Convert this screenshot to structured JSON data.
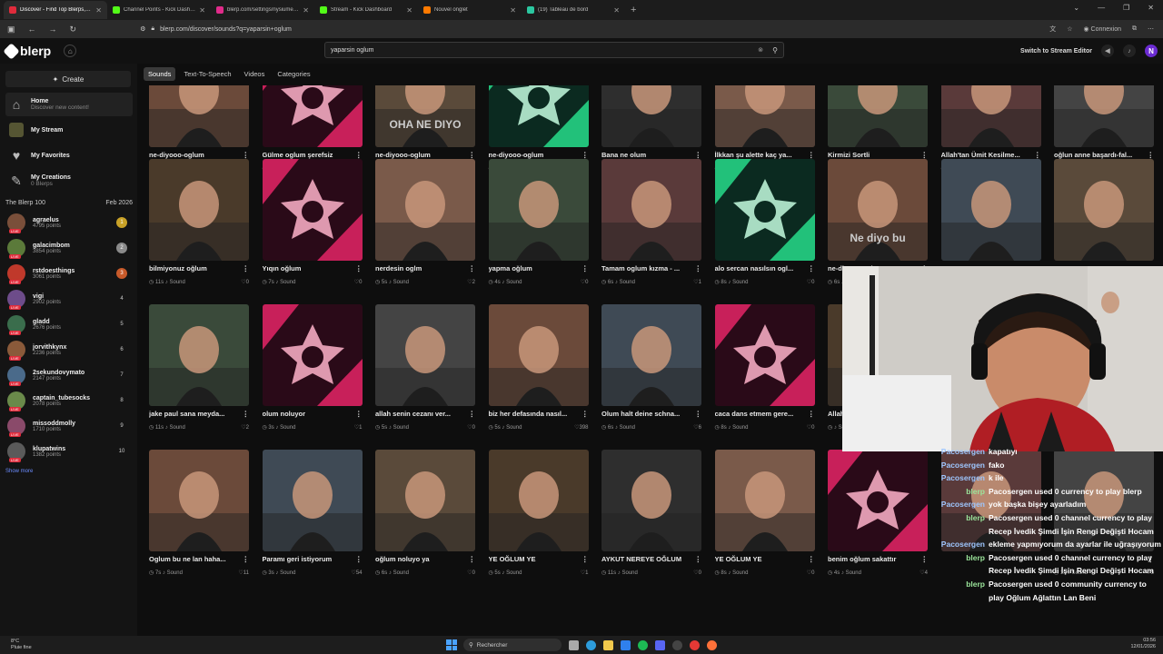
{
  "browser": {
    "tabs": [
      {
        "title": "Discover - Find Top Blerps, Sto",
        "color": "#e02b3b",
        "active": true
      },
      {
        "title": "Channel Points - Kick Dashboar",
        "color": "#53fc18",
        "active": false
      },
      {
        "title": "blerp.com/settings/nysiumerTs",
        "color": "#e02b8a",
        "active": false
      },
      {
        "title": "Stream - Kick Dashboard",
        "color": "#53fc18",
        "active": false
      },
      {
        "title": "Nouvel onglet",
        "color": "#ff7a00",
        "active": false
      },
      {
        "title": "(19) Tableau de bord",
        "color": "#2bc7a0",
        "active": false
      }
    ],
    "url": "blerp.com/discover/sounds?q=yaparsin+oglum",
    "profile_label": "Connexion"
  },
  "site": {
    "logo": "blerp",
    "search_value": "yaparsin oglum",
    "switch_label": "Switch to Stream Editor",
    "avatar_letter": "N"
  },
  "sidebar": {
    "create": "Create",
    "nav": [
      {
        "title": "Home",
        "sub": "Discover new content!"
      },
      {
        "title": "My Stream",
        "sub": ""
      },
      {
        "title": "My Favorites",
        "sub": ""
      },
      {
        "title": "My Creations",
        "sub": "0 Blerps"
      }
    ],
    "board_title": "The Blerp 100",
    "board_date": "Feb 2026",
    "ranks": [
      {
        "name": "agraelus",
        "points": "4795 points",
        "n": "1",
        "color": "#c9a227"
      },
      {
        "name": "galacimbom",
        "points": "3854 points",
        "n": "2",
        "color": "#8a8a8a"
      },
      {
        "name": "rstdoesthings",
        "points": "3061 points",
        "n": "3",
        "color": "#c85a2a"
      },
      {
        "name": "vigi",
        "points": "2902 points",
        "n": "4",
        "color": ""
      },
      {
        "name": "gladd",
        "points": "2676 points",
        "n": "5",
        "color": ""
      },
      {
        "name": "jorvithkynx",
        "points": "2236 points",
        "n": "6",
        "color": ""
      },
      {
        "name": "2sekundovymato",
        "points": "2147 points",
        "n": "7",
        "color": ""
      },
      {
        "name": "captain_tubesocks",
        "points": "2078 points",
        "n": "8",
        "color": ""
      },
      {
        "name": "missoddmolly",
        "points": "1710 points",
        "n": "9",
        "color": ""
      },
      {
        "name": "klupatwins",
        "points": "1382 points",
        "n": "10",
        "color": ""
      }
    ],
    "show_more": "Show more"
  },
  "filters": [
    "Sounds",
    "Text-To-Speech",
    "Videos",
    "Categories"
  ],
  "rows": [
    [
      {
        "title": "ne-diyooo-oglum",
        "dur": "6s",
        "likes": "0",
        "thumb": "photo"
      },
      {
        "title": "Gülme oglum şerefsiz",
        "dur": "3s",
        "likes": "0",
        "thumb": "pink"
      },
      {
        "title": "ne-diyooo-oglum",
        "dur": "6s",
        "likes": "0",
        "thumb": "text",
        "text": "OHA NE DIYO"
      },
      {
        "title": "ne-diyooo-oglum",
        "dur": "6s",
        "likes": "0",
        "thumb": "green"
      },
      {
        "title": "Bana ne olum",
        "dur": "1s",
        "likes": "1",
        "thumb": "photo"
      },
      {
        "title": "İlkkan şu alette kaç ya...",
        "dur": "9s",
        "likes": "5",
        "thumb": "photo"
      },
      {
        "title": "Kirmizi Sortli",
        "dur": "3s",
        "likes": "9",
        "thumb": "photo"
      },
      {
        "title": "Allah'tan Ümit Kesilme...",
        "dur": "5s",
        "likes": "0",
        "thumb": "photo"
      },
      {
        "title": "oğlun anne başardı-fal...",
        "dur": "3s",
        "likes": "0",
        "thumb": "photo"
      }
    ],
    [
      {
        "title": "bilmiyonuz oğlum",
        "dur": "11s",
        "likes": "0",
        "thumb": "photo"
      },
      {
        "title": "Yıqın oğlum",
        "dur": "7s",
        "likes": "0",
        "thumb": "pink"
      },
      {
        "title": "nerdesin oglm",
        "dur": "5s",
        "likes": "2",
        "thumb": "photo"
      },
      {
        "title": "yapma oğlum",
        "dur": "4s",
        "likes": "0",
        "thumb": "photo"
      },
      {
        "title": "Tamam oglum kızma - ...",
        "dur": "6s",
        "likes": "1",
        "thumb": "photo"
      },
      {
        "title": "alo sercan nasılsın ogl...",
        "dur": "8s",
        "likes": "0",
        "thumb": "green"
      },
      {
        "title": "ne-diyooo-oglum",
        "dur": "6s",
        "likes": "0",
        "thumb": "text",
        "text": "Ne diyo bu"
      },
      {
        "title": "",
        "dur": "",
        "likes": "",
        "thumb": "photo"
      },
      {
        "title": "",
        "dur": "",
        "likes": "",
        "thumb": "photo"
      }
    ],
    [
      {
        "title": "jake paul sana meyda...",
        "dur": "11s",
        "likes": "2",
        "thumb": "photo"
      },
      {
        "title": "olum noluyor",
        "dur": "3s",
        "likes": "1",
        "thumb": "pink"
      },
      {
        "title": "allah senin cezanı ver...",
        "dur": "5s",
        "likes": "0",
        "thumb": "photo"
      },
      {
        "title": "biz her defasında nasıl...",
        "dur": "5s",
        "likes": "398",
        "thumb": "photo"
      },
      {
        "title": "Olum halt deine schna...",
        "dur": "6s",
        "likes": "6",
        "thumb": "photo"
      },
      {
        "title": "caca dans etmem gere...",
        "dur": "8s",
        "likes": "0",
        "thumb": "pink"
      },
      {
        "title": "Allah...",
        "dur": "",
        "likes": "",
        "thumb": "photo"
      }
    ],
    [
      {
        "title": "Oglum bu ne lan haha...",
        "dur": "7s",
        "likes": "11",
        "thumb": "photo"
      },
      {
        "title": "Paramı geri istiyorum",
        "dur": "3s",
        "likes": "54",
        "thumb": "photo"
      },
      {
        "title": "oğlum noluyo ya",
        "dur": "6s",
        "likes": "0",
        "thumb": "photo"
      },
      {
        "title": "YE OĞLUM YE",
        "dur": "5s",
        "likes": "1",
        "thumb": "photo"
      },
      {
        "title": "AYKUT NEREYE OĞLUM",
        "dur": "11s",
        "likes": "0",
        "thumb": "photo"
      },
      {
        "title": "YE OĞLUM YE",
        "dur": "8s",
        "likes": "0",
        "thumb": "photo"
      },
      {
        "title": "benim oğlum sakattır",
        "dur": "4s",
        "likes": "4",
        "thumb": "pink"
      },
      {
        "title": "",
        "dur": "",
        "likes": "",
        "thumb": "photo"
      },
      {
        "title": "",
        "dur": "1s",
        "likes": "5",
        "thumb": "photo"
      }
    ]
  ],
  "sound_label": "Sound",
  "chat": [
    {
      "who": "Pacosergen",
      "msg": "kapatıyı",
      "bot": false
    },
    {
      "who": "Pacosergen",
      "msg": "fako",
      "bot": false
    },
    {
      "who": "Pacosergen",
      "msg": "k ile",
      "bot": false
    },
    {
      "who": "blerp",
      "msg": "Pacosergen used 0 currency to play blerp",
      "bot": true
    },
    {
      "who": "Pacosergen",
      "msg": "yok başka bişey ayarladım",
      "bot": false
    },
    {
      "who": "blerp",
      "msg": "Pacosergen used 0 channel currency to play Recep İvedik Şimdi İşin Rengi Değişti Hocam",
      "bot": true
    },
    {
      "who": "Pacosergen",
      "msg": "ekleme yapmıyorum da ayarlar ile uğraşıyorum",
      "bot": false
    },
    {
      "who": "blerp",
      "msg": "Pacosergen used 0 channel currency to play Recep İvedik Şimdi İşin Rengi Değişti Hocam",
      "bot": true
    },
    {
      "who": "blerp",
      "msg": "Pacosergen used 0 community currency to play Oğlum Ağlattın Lan Beni",
      "bot": true
    }
  ],
  "taskbar": {
    "temp": "8°C",
    "weather": "Pluie fine",
    "search": "Rechercher",
    "time": "03:56",
    "date": "12/01/2026"
  },
  "colors": {
    "accent": "#e02b3b",
    "bg": "#0e0e0e",
    "pink": "#c8205a",
    "green": "#22c17a"
  }
}
